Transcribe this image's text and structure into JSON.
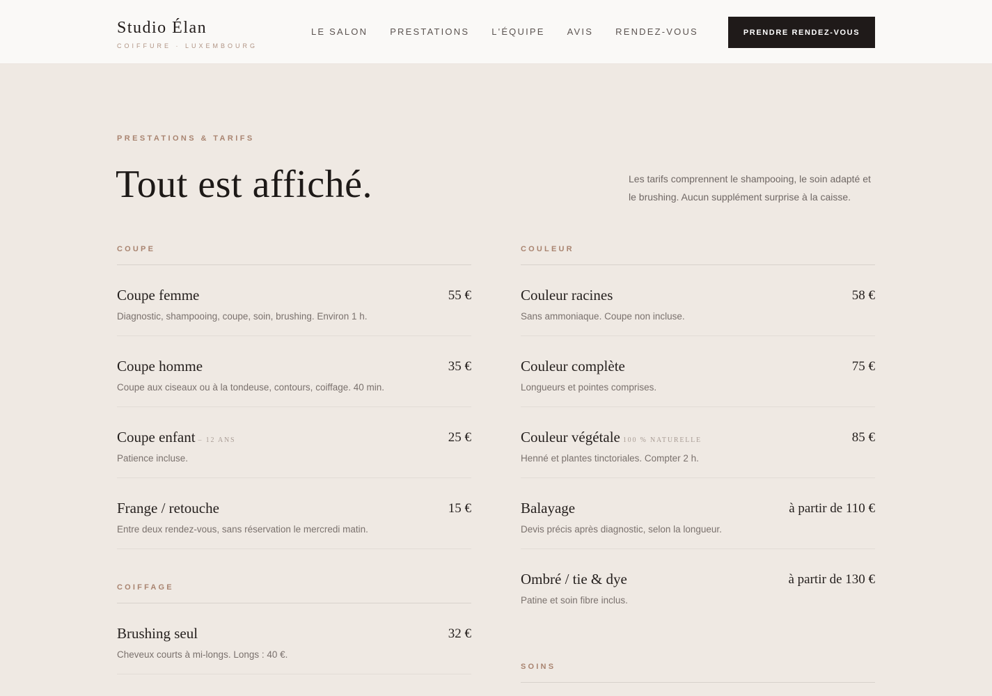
{
  "header": {
    "brand_name": "Studio Élan",
    "brand_tagline": "COIFFURE · LUXEMBOURG",
    "nav": [
      "LE SALON",
      "PRESTATIONS",
      "L'ÉQUIPE",
      "AVIS",
      "RENDEZ-VOUS"
    ],
    "cta_label": "PRENDRE RENDEZ-VOUS"
  },
  "intro": {
    "eyebrow": "PRESTATIONS & TARIFS",
    "title": "Tout est affiché.",
    "text": "Les tarifs comprennent le shampooing, le soin adapté et le brushing. Aucun supplément surprise à la caisse."
  },
  "left_column": {
    "coupe": {
      "label": "COUPE",
      "items": [
        {
          "name": "Coupe femme",
          "tag": "",
          "price": "55 €",
          "desc": "Diagnostic, shampooing, coupe, soin, brushing. Environ 1 h."
        },
        {
          "name": "Coupe homme",
          "tag": "",
          "price": "35 €",
          "desc": "Coupe aux ciseaux ou à la tondeuse, contours, coiffage. 40 min."
        },
        {
          "name": "Coupe enfant",
          "tag": "– 12 ANS",
          "price": "25 €",
          "desc": "Patience incluse."
        },
        {
          "name": "Frange / retouche",
          "tag": "",
          "price": "15 €",
          "desc": "Entre deux rendez-vous, sans réservation le mercredi matin."
        }
      ]
    },
    "coiffage": {
      "label": "COIFFAGE",
      "items": [
        {
          "name": "Brushing seul",
          "tag": "",
          "price": "32 €",
          "desc": "Cheveux courts à mi-longs. Longs : 40 €."
        }
      ]
    }
  },
  "right_column": {
    "couleur": {
      "label": "COULEUR",
      "items": [
        {
          "name": "Couleur racines",
          "tag": "",
          "price": "58 €",
          "desc": "Sans ammoniaque. Coupe non incluse."
        },
        {
          "name": "Couleur complète",
          "tag": "",
          "price": "75 €",
          "desc": "Longueurs et pointes comprises."
        },
        {
          "name": "Couleur végétale",
          "tag": "100 % NATURELLE",
          "price": "85 €",
          "desc": "Henné et plantes tinctoriales. Compter 2 h."
        },
        {
          "name": "Balayage",
          "tag": "",
          "price": "à partir de 110 €",
          "desc": "Devis précis après diagnostic, selon la longueur."
        },
        {
          "name": "Ombré / tie & dye",
          "tag": "",
          "price": "à partir de 130 €",
          "desc": "Patine et soin fibre inclus."
        }
      ]
    },
    "soins": {
      "label": "SOINS"
    }
  }
}
